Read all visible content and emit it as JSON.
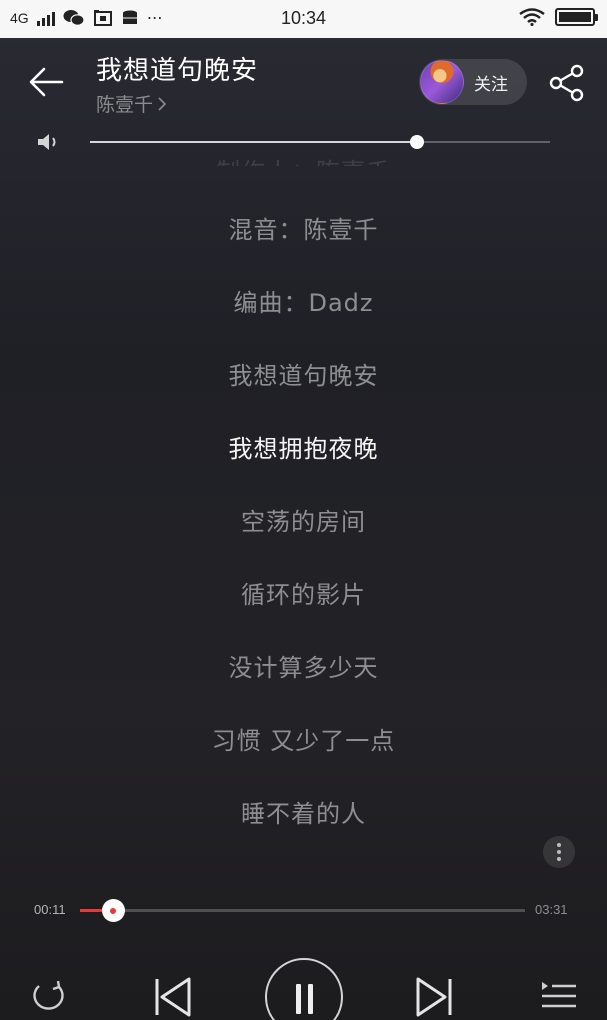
{
  "status_bar": {
    "network": "4G",
    "time": "10:34"
  },
  "header": {
    "title": "我想道句晚安",
    "artist": "陈壹千",
    "follow_label": "关注"
  },
  "volume": {
    "level": 0.71
  },
  "lyrics": {
    "ghost_line": "制作人：陈壹千",
    "lines": [
      {
        "text": "混音：陈壹千",
        "active": false
      },
      {
        "text": "编曲：Dadz",
        "active": false
      },
      {
        "text": "我想道句晚安",
        "active": false
      },
      {
        "text": "我想拥抱夜晚",
        "active": true
      },
      {
        "text": "空荡的房间",
        "active": false
      },
      {
        "text": "循环的影片",
        "active": false
      },
      {
        "text": "没计算多少天",
        "active": false
      },
      {
        "text": "习惯 又少了一点",
        "active": false
      },
      {
        "text": "睡不着的人",
        "active": false
      }
    ]
  },
  "progress": {
    "current_time": "00:11",
    "total_time": "03:31",
    "fraction": 0.074
  },
  "colors": {
    "accent": "#e33a3a",
    "background": "#222228"
  },
  "controls": {
    "icons": [
      "loop-icon",
      "previous-icon",
      "pause-icon",
      "next-icon",
      "playlist-icon"
    ]
  }
}
